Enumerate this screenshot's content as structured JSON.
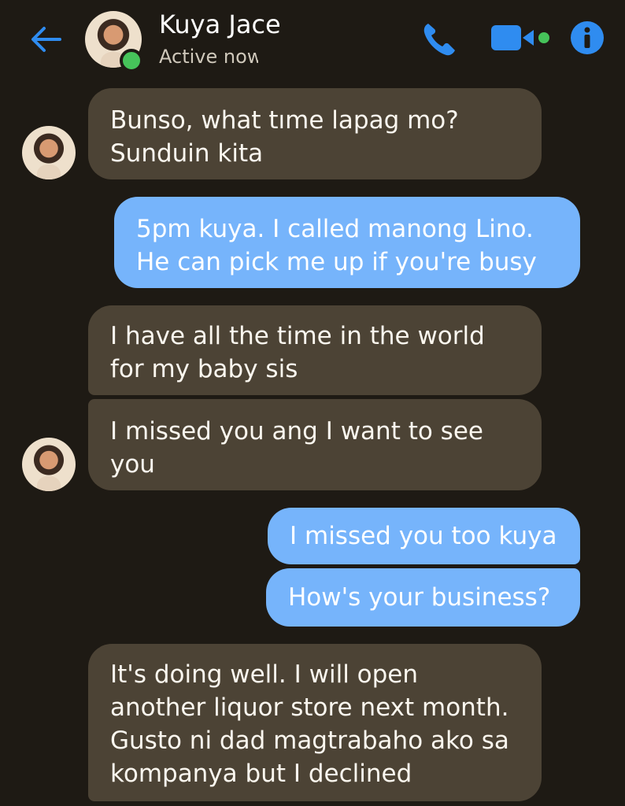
{
  "header": {
    "contact_name": "Kuya Jace",
    "status": "Active now",
    "icons": [
      "back-arrow-icon",
      "phone-icon",
      "video-call-icon",
      "info-icon"
    ]
  },
  "colors": {
    "accent": "#2f8cf0",
    "incoming_bubble": "#4c4335",
    "outgoing_bubble": "#76b4fb",
    "background": "#1e1a14",
    "online": "#46c35a"
  },
  "messages": [
    {
      "from": "contact",
      "text": "Bunso, what tıme lapag mo?\nSunduin kita"
    },
    {
      "from": "me",
      "text": "5pm kuya. I called manong Lino.\nHe can pick me up if you're busy"
    },
    {
      "from": "contact",
      "text": "I have all the time in the world\nfor my baby sis"
    },
    {
      "from": "contact",
      "text": "I missed you ang I want to see\nyou"
    },
    {
      "from": "me",
      "text": "I missed you too kuya"
    },
    {
      "from": "me",
      "text": "How's your business?"
    },
    {
      "from": "contact",
      "text": "It's doing well. I will open\nanother liquor store next month.\nGusto ni dad magtrabaho ako sa\nkompanya but I declined"
    }
  ]
}
